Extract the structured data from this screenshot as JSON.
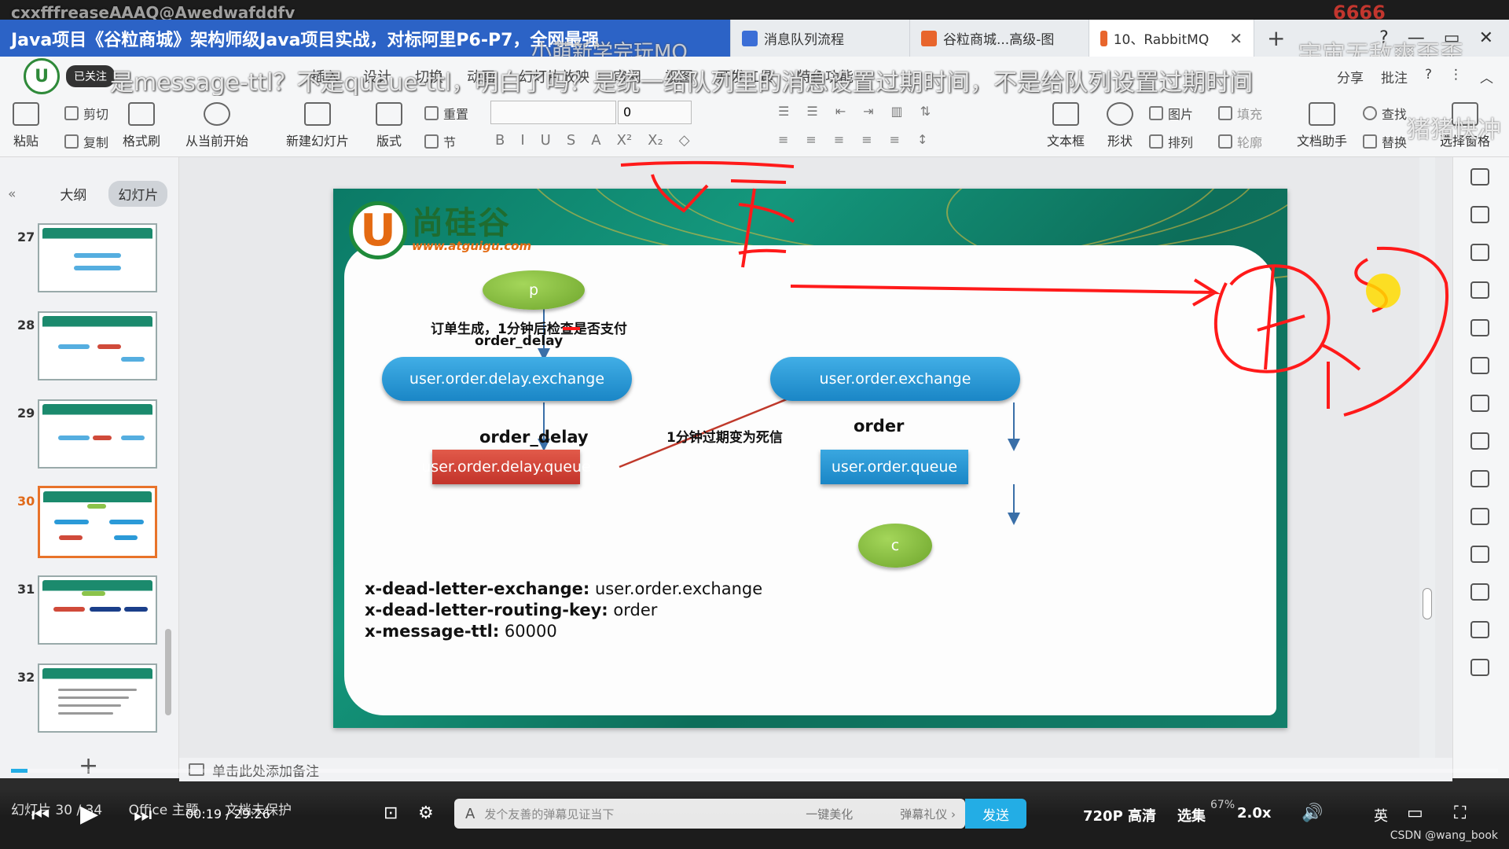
{
  "window": {
    "watermark_top": "cxxfffreaseAAAQ@Awedwafddfv",
    "stream_number": "6666",
    "video_title": "Java项目《谷粒商城》架构师级Java项目实战，对标阿里P6-P7，全网最强",
    "tabs": [
      {
        "label": "消息队列流程",
        "icon_color": "#3b6ed6"
      },
      {
        "label": "谷粒商城...高级-图",
        "icon_color": "#e8652c"
      },
      {
        "label": "10、RabbitMQ",
        "icon_color": "#e8652c",
        "active": true
      }
    ],
    "new_tab": "+",
    "danmu_right": "宇宙无敌爽歪歪",
    "danmu_mid": "小萌新学完玩MQ",
    "danmu_side": "猪猪快冲"
  },
  "menubar": {
    "follow_label": "已关注",
    "items": [
      "插入",
      "设计",
      "切换",
      "动画",
      "幻灯片放映",
      "审阅",
      "视图",
      "开发工具",
      "特色功能"
    ],
    "share": "分享",
    "comment": "批注",
    "danmu": "是message-ttl？不是queue-ttl，明白了吗？是统一给队列里的消息设置过期时间，不是给队列设置过期时间"
  },
  "ribbon": {
    "paste": "粘贴",
    "cut": "剪切",
    "copy": "复制",
    "format_painter": "格式刷",
    "play_from_current": "从当前开始",
    "new_slide": "新建幻灯片",
    "layout": "版式",
    "reset": "重置",
    "section": "节",
    "font_size": "0",
    "textbox": "文本框",
    "shape": "形状",
    "picture": "图片",
    "arrange": "排列",
    "fill": "填充",
    "outline": "轮廓",
    "doc_assistant": "文档助手",
    "find": "查找",
    "replace": "替换",
    "select_pane": "选择窗格"
  },
  "leftpanel": {
    "tab_outline": "大纲",
    "tab_slides": "幻灯片",
    "thumbs": [
      {
        "num": "27"
      },
      {
        "num": "28"
      },
      {
        "num": "29"
      },
      {
        "num": "30",
        "active": true
      },
      {
        "num": "31"
      },
      {
        "num": "32"
      }
    ],
    "add": "+"
  },
  "slide": {
    "logo_text": "尚硅谷",
    "logo_url": "www.atguigu.com",
    "producer": "p",
    "label_order_create": "订单生成，1分钟后检查是否支付",
    "label_order_delay_small": "order_delay",
    "delay_exchange": "user.order.delay.exchange",
    "order_exchange": "user.order.exchange",
    "label_order_delay": "order_delay",
    "label_order": "order",
    "delay_queue": "user.order.delay.queue",
    "order_queue": "user.order.queue",
    "label_dead_letter": "1分钟过期变为死信",
    "consumer": "c",
    "args": [
      {
        "key": "x-dead-letter-exchange:",
        "value": "user.order.exchange"
      },
      {
        "key": "x-dead-letter-routing-key:",
        "value": "order"
      },
      {
        "key": "x-message-ttl:",
        "value": "60000"
      }
    ]
  },
  "notes": {
    "placeholder": "单击此处添加备注"
  },
  "statusbar": {
    "slide_info": "幻灯片 30 / 34",
    "theme": "Office 主题",
    "protect": "文档未保护",
    "beautify": "一键美化",
    "zoom": "67%"
  },
  "player": {
    "time": "00:19 / 29:26",
    "progress": 0.011,
    "danmu_placeholder": "发个友善的弹幕见证当下",
    "gift": "弹幕礼仪 ›",
    "send": "发送",
    "quality": "720P 高清",
    "episodes": "选集",
    "speed": "2.0x",
    "lang": "英",
    "credit": "CSDN @wang_book"
  },
  "colors": {
    "tab_blue": "#2c63c6",
    "slide_green": "#0b7a66",
    "annot_red": "#ff1a1a",
    "accent_blue": "#23ade5"
  }
}
